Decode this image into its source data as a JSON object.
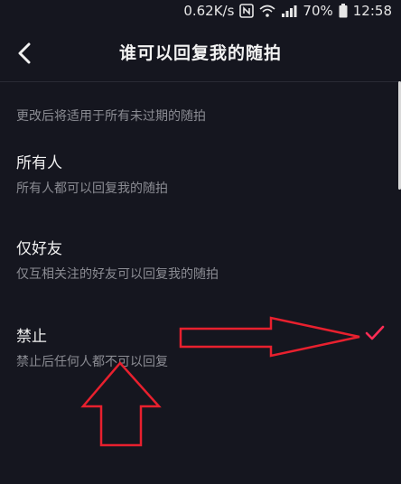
{
  "status_bar": {
    "speed": "0.62K/s",
    "battery": "70%",
    "time": "12:58"
  },
  "nav": {
    "title": "谁可以回复我的随拍"
  },
  "hint": "更改后将适用于所有未过期的随拍",
  "options": [
    {
      "title": "所有人",
      "desc": "所有人都可以回复我的随拍",
      "selected": false
    },
    {
      "title": "仅好友",
      "desc": "仅互相关注的好友可以回复我的随拍",
      "selected": false
    },
    {
      "title": "禁止",
      "desc": "禁止后任何人都不可以回复",
      "selected": true
    }
  ],
  "colors": {
    "background": "#15161f",
    "accent": "#fe2c55",
    "annotation": "#e8202e"
  },
  "icons": [
    "nfc-icon",
    "wifi-icon",
    "signal-icon",
    "battery-icon",
    "back-chevron-icon",
    "checkmark-icon"
  ]
}
